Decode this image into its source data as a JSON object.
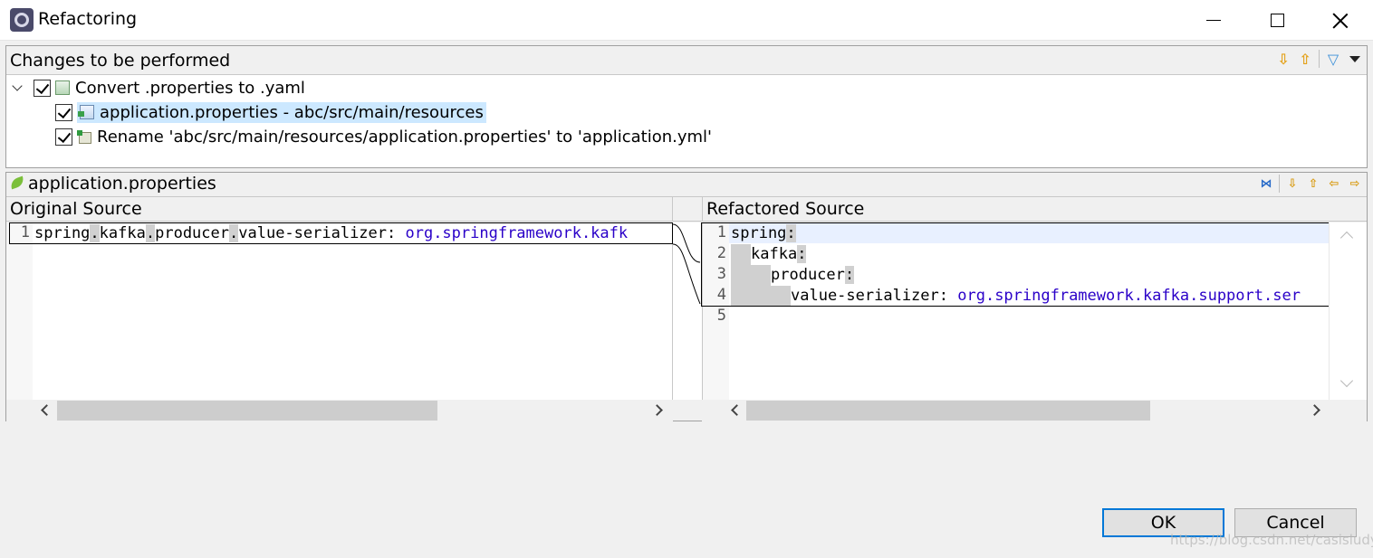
{
  "window": {
    "title": "Refactoring",
    "icon": "eclipse-app-icon",
    "controls": [
      "minimize",
      "maximize",
      "close"
    ]
  },
  "changes": {
    "header": "Changes to be performed",
    "toolbar_icons": [
      "next-change-icon",
      "previous-change-icon",
      "filter-icon",
      "view-menu-icon"
    ],
    "root": {
      "label": "Convert .properties to .yaml",
      "checked": true,
      "expanded": true
    },
    "children": [
      {
        "label": "application.properties - abc/src/main/resources",
        "checked": true,
        "selected": true
      },
      {
        "label": "Rename 'abc/src/main/resources/application.properties' to 'application.yml'",
        "checked": true,
        "selected": false
      }
    ]
  },
  "compare": {
    "title": "application.properties",
    "toolbar_icons": [
      "ignore-whitespace-icon",
      "next-difference-icon",
      "previous-difference-icon",
      "copy-left-icon",
      "copy-right-icon"
    ],
    "left": {
      "header": "Original Source",
      "lines": [
        {
          "num": "1",
          "parts": [
            {
              "t": "spring",
              "c": ""
            },
            {
              "t": ".",
              "c": "dot"
            },
            {
              "t": "kafka",
              "c": ""
            },
            {
              "t": ".",
              "c": "dot"
            },
            {
              "t": "producer",
              "c": ""
            },
            {
              "t": ".",
              "c": "dot"
            },
            {
              "t": "value-serializer: ",
              "c": ""
            },
            {
              "t": "org.springframework.kafk",
              "c": "val"
            }
          ]
        }
      ]
    },
    "right": {
      "header": "Refactored Source",
      "lines": [
        {
          "num": "1",
          "indent": 0,
          "key": "spring",
          "sep": ":",
          "value": ""
        },
        {
          "num": "2",
          "indent": 1,
          "key": "kafka",
          "sep": ":",
          "value": ""
        },
        {
          "num": "3",
          "indent": 2,
          "key": "producer",
          "sep": ":",
          "value": ""
        },
        {
          "num": "4",
          "indent": 3,
          "key": "value-serializer",
          "sep": ": ",
          "value": "org.springframework.kafka.support.ser"
        },
        {
          "num": "5",
          "indent": 0,
          "key": "",
          "sep": "",
          "value": ""
        }
      ]
    }
  },
  "buttons": {
    "ok": "OK",
    "cancel": "Cancel"
  },
  "watermark": "https://blog.csdn.net/casisludy"
}
